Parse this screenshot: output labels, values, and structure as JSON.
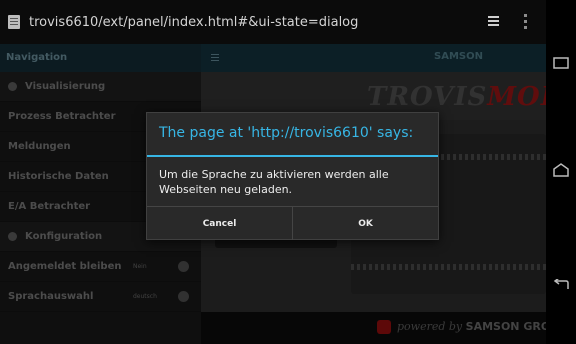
{
  "browser": {
    "url": "trovis6610/ext/panel/index.html#&ui-state=dialog",
    "icons": [
      "page-icon",
      "tabs-icon",
      "overflow-menu-icon"
    ]
  },
  "navbar": {
    "icons": [
      "recent-apps-icon",
      "home-icon",
      "back-icon"
    ]
  },
  "sidebar": {
    "title": "Navigation",
    "items": [
      {
        "label": "Visualisierung",
        "type": "section"
      },
      {
        "label": "Prozess Betrachter"
      },
      {
        "label": "Meldungen"
      },
      {
        "label": "Historische Daten"
      },
      {
        "label": "E/A Betrachter"
      },
      {
        "label": "Konfiguration",
        "type": "section"
      },
      {
        "label": "Angemeldet bleiben",
        "value": "Nein"
      },
      {
        "label": "Sprachauswahl",
        "value": "deutsch"
      }
    ]
  },
  "main": {
    "header_brand": "SAMSON",
    "logo": {
      "part1": "TROVIS",
      "part2": "MOBIL"
    },
    "footer": {
      "powered": "powered by",
      "brand": "SAMSON GROUP"
    }
  },
  "dialog": {
    "title": "The page at 'http://trovis6610' says:",
    "message": "Um die Sprache zu aktivieren werden alle Webseiten neu geladen.",
    "cancel_label": "Cancel",
    "ok_label": "OK",
    "accent_color": "#37b6e5"
  }
}
